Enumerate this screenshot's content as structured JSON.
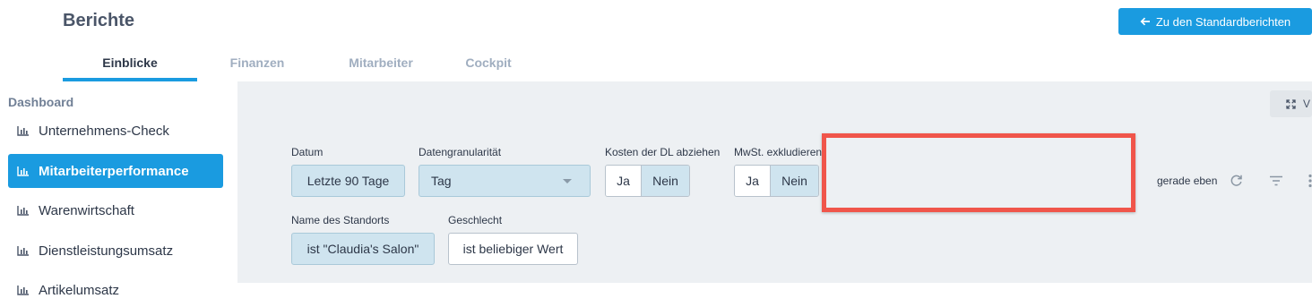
{
  "header": {
    "title": "Berichte",
    "back_button": "Zu den Standardberichten",
    "tabs": [
      "Einblicke",
      "Finanzen",
      "Mitarbeiter",
      "Cockpit"
    ]
  },
  "sidebar": {
    "heading": "Dashboard",
    "items": [
      {
        "label": "Unternehmens-Check"
      },
      {
        "label": "Mitarbeiterperformance"
      },
      {
        "label": "Warenwirtschaft"
      },
      {
        "label": "Dienstleistungsumsatz"
      },
      {
        "label": "Artikelumsatz"
      }
    ]
  },
  "toolbar": {
    "view_button": "V"
  },
  "filters": {
    "datum": {
      "label": "Datum",
      "value": "Letzte 90 Tage"
    },
    "granularity": {
      "label": "Datengranularität",
      "value": "Tag"
    },
    "kosten": {
      "label": "Kosten der DL abziehen",
      "yes": "Ja",
      "no": "Nein"
    },
    "mwst": {
      "label": "MwSt. exkludieren",
      "yes": "Ja",
      "no": "Nein"
    },
    "standort": {
      "label": "Name des Standorts",
      "value": "ist \"Claudia's Salon\""
    },
    "geschlecht": {
      "label": "Geschlecht",
      "value": "ist beliebiger Wert"
    }
  },
  "status": {
    "updated": "gerade eben"
  },
  "colors": {
    "accent": "#1a9be0",
    "highlight": "#f0554a"
  }
}
